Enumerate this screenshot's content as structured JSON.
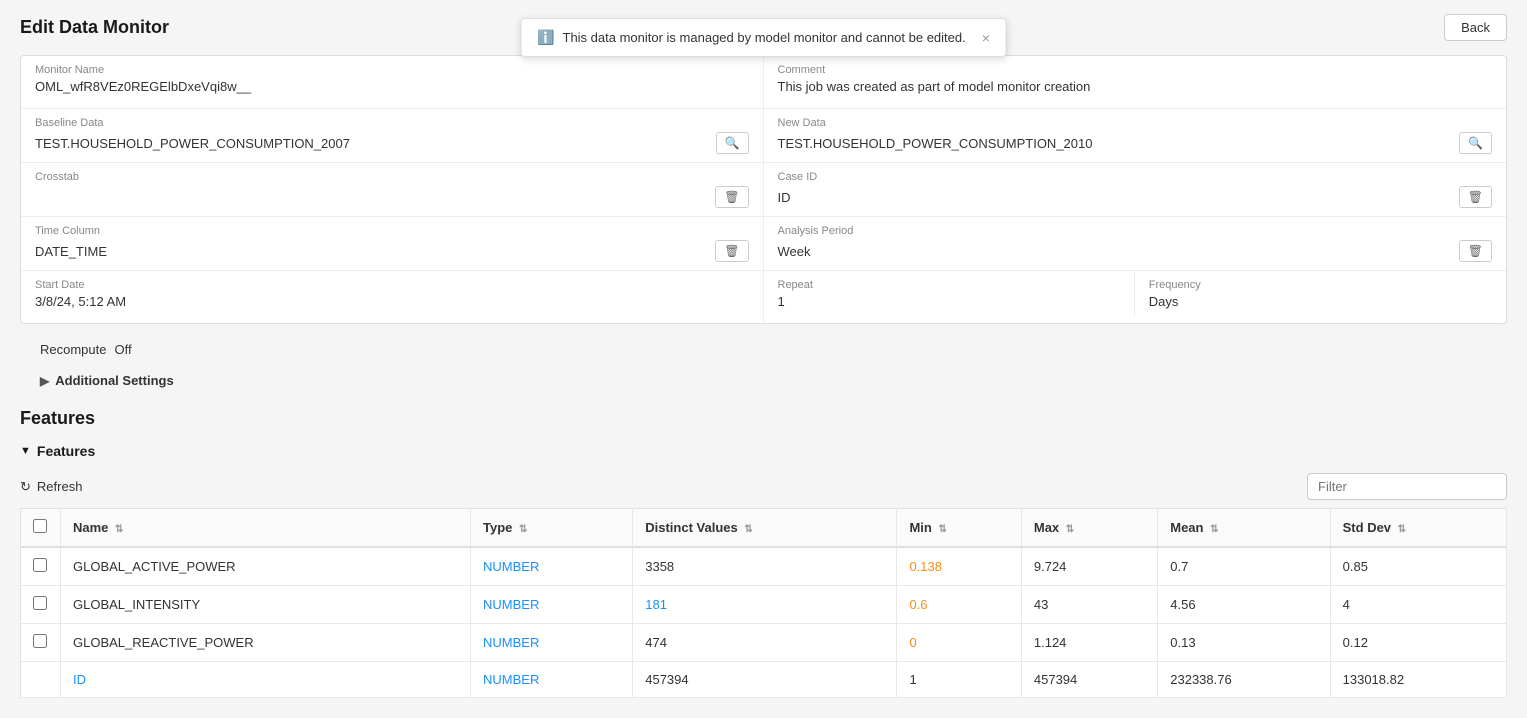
{
  "header": {
    "title": "Edit Data Monitor",
    "back_button": "Back"
  },
  "toast": {
    "message": "This data monitor is managed by model monitor and cannot be edited.",
    "icon": "ℹ",
    "close": "×"
  },
  "form": {
    "monitor_name_label": "Monitor Name",
    "monitor_name_value": "OML_wfR8VEz0REGElbDxeVqi8w__",
    "comment_label": "Comment",
    "comment_value": "This job was created as part of model monitor creation",
    "baseline_data_label": "Baseline Data",
    "baseline_data_value": "TEST.HOUSEHOLD_POWER_CONSUMPTION_2007",
    "new_data_label": "New Data",
    "new_data_value": "TEST.HOUSEHOLD_POWER_CONSUMPTION_2010",
    "crosstab_label": "Crosstab",
    "crosstab_value": "",
    "case_id_label": "Case ID",
    "case_id_value": "ID",
    "time_column_label": "Time Column",
    "time_column_value": "DATE_TIME",
    "analysis_period_label": "Analysis Period",
    "analysis_period_value": "Week",
    "start_date_label": "Start Date",
    "start_date_value": "3/8/24, 5:12 AM",
    "repeat_label": "Repeat",
    "repeat_value": "1",
    "frequency_label": "Frequency",
    "frequency_value": "Days",
    "recompute_label": "Recompute",
    "recompute_value": "Off",
    "additional_settings_label": "Additional Settings"
  },
  "features": {
    "section_title": "Features",
    "subsection_title": "Features",
    "refresh_label": "Refresh",
    "filter_placeholder": "Filter",
    "table": {
      "columns": [
        {
          "id": "name",
          "label": "Name"
        },
        {
          "id": "type",
          "label": "Type"
        },
        {
          "id": "distinct_values",
          "label": "Distinct Values"
        },
        {
          "id": "min",
          "label": "Min"
        },
        {
          "id": "max",
          "label": "Max"
        },
        {
          "id": "mean",
          "label": "Mean"
        },
        {
          "id": "std_dev",
          "label": "Std Dev"
        }
      ],
      "rows": [
        {
          "name": "GLOBAL_ACTIVE_POWER",
          "type": "NUMBER",
          "distinct_values": "3358",
          "min": "0.138",
          "max": "9.724",
          "mean": "0.7",
          "std_dev": "0.85",
          "min_link": true,
          "dv_link": false
        },
        {
          "name": "GLOBAL_INTENSITY",
          "type": "NUMBER",
          "distinct_values": "181",
          "min": "0.6",
          "max": "43",
          "mean": "4.56",
          "std_dev": "4",
          "min_link": true,
          "dv_link": true
        },
        {
          "name": "GLOBAL_REACTIVE_POWER",
          "type": "NUMBER",
          "distinct_values": "474",
          "min": "0",
          "max": "1.124",
          "mean": "0.13",
          "std_dev": "0.12",
          "min_link": true,
          "dv_link": false
        },
        {
          "name": "ID",
          "type": "NUMBER",
          "distinct_values": "457394",
          "min": "1",
          "max": "457394",
          "mean": "232338.76",
          "std_dev": "133018.82",
          "min_link": false,
          "dv_link": false
        }
      ]
    }
  },
  "colors": {
    "accent": "#1890ff",
    "orange": "#fa8c16",
    "link": "#1890ff"
  }
}
